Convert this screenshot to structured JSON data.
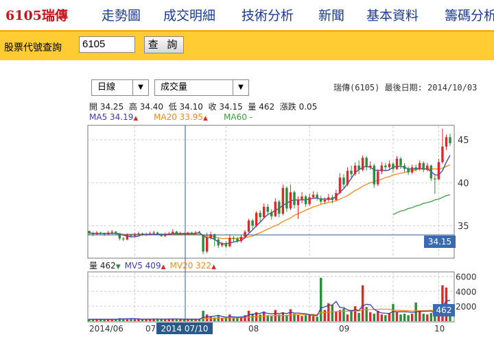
{
  "nav": {
    "brand": "6105瑞傳",
    "items": [
      "走勢圖",
      "成交明細",
      "技術分析",
      "新聞",
      "基本資料",
      "籌碼分析"
    ]
  },
  "query": {
    "label": "股票代號查詢",
    "value": "6105",
    "button": "查 詢"
  },
  "selects": {
    "period": "日線",
    "indicator": "成交量"
  },
  "header": {
    "stock": "瑞傳(6105)",
    "last_date_label": "最後日期:",
    "last_date": "2014/10/03"
  },
  "ohlc": {
    "open_label": "開",
    "open": "34.25",
    "high_label": "高",
    "high": "34.40",
    "low_label": "低",
    "low": "34.10",
    "close_label": "收",
    "close": "34.15",
    "vol_label": "量",
    "vol": "462",
    "chg_label": "漲跌",
    "chg": "0.05"
  },
  "ma": {
    "ma5": "MA5 34.19",
    "ma20": "MA20 33.95",
    "ma60": "MA60 -",
    "ma5_color": "#3b3bb0",
    "ma20_color": "#f08a1a",
    "ma60_color": "#3c9a3c"
  },
  "vol_legend": {
    "vol": "量 462",
    "mv5": "MV5 409",
    "mv20": "MV20 322"
  },
  "colors": {
    "up": "#d92b2b",
    "down": "#2e8b3a",
    "badge": "#3a6bb0"
  },
  "chart_data": {
    "type": "candlestick",
    "price_ticks": [
      "45",
      "40",
      "35"
    ],
    "price_range": [
      31.3,
      46.6
    ],
    "volume_ticks": [
      "6000",
      "4000",
      "2000"
    ],
    "volume_range": [
      0,
      6500
    ],
    "x_ticks": [
      "2014/06",
      "07",
      "08",
      "09",
      "10"
    ],
    "cursor_date": "2014 07/10",
    "last_price_badge": "34.15",
    "last_volume_badge": "462",
    "candles": [
      [
        34.4,
        34.1,
        34.4,
        33.9
      ],
      [
        34.1,
        34.0,
        34.3,
        33.8
      ],
      [
        34.0,
        34.2,
        34.4,
        33.9
      ],
      [
        34.2,
        34.1,
        34.3,
        33.9
      ],
      [
        34.1,
        34.0,
        34.2,
        33.8
      ],
      [
        34.0,
        34.2,
        34.4,
        33.9
      ],
      [
        34.2,
        34.3,
        34.5,
        34.0
      ],
      [
        34.3,
        34.1,
        34.4,
        33.9
      ],
      [
        34.1,
        33.5,
        34.1,
        33.3
      ],
      [
        33.5,
        33.4,
        33.7,
        33.2
      ],
      [
        33.4,
        33.9,
        34.1,
        33.3
      ],
      [
        33.9,
        33.8,
        34.0,
        33.6
      ],
      [
        33.8,
        34.0,
        34.2,
        33.7
      ],
      [
        34.0,
        34.1,
        34.3,
        33.9
      ],
      [
        34.1,
        33.9,
        34.2,
        33.8
      ],
      [
        33.9,
        34.0,
        34.2,
        33.8
      ],
      [
        34.0,
        34.1,
        34.3,
        33.9
      ],
      [
        34.1,
        34.2,
        34.4,
        34.0
      ],
      [
        34.2,
        34.0,
        34.3,
        33.9
      ],
      [
        34.0,
        33.8,
        34.1,
        33.7
      ],
      [
        33.8,
        34.0,
        34.2,
        33.7
      ],
      [
        34.0,
        34.1,
        34.3,
        33.9
      ],
      [
        34.1,
        34.3,
        34.6,
        34.0
      ],
      [
        34.3,
        34.0,
        34.4,
        33.9
      ],
      [
        34.0,
        34.1,
        34.3,
        33.9
      ],
      [
        34.1,
        34.0,
        34.2,
        33.9
      ],
      [
        34.0,
        34.2,
        34.3,
        33.9
      ],
      [
        34.2,
        34.1,
        34.3,
        34.0
      ],
      [
        34.1,
        34.2,
        34.4,
        34.0
      ],
      [
        34.3,
        34.2,
        34.4,
        34.1
      ],
      [
        33.9,
        32.0,
        34.0,
        31.7
      ],
      [
        32.0,
        33.6,
        34.2,
        31.8
      ],
      [
        33.6,
        34.0,
        34.3,
        33.4
      ],
      [
        34.0,
        33.4,
        34.1,
        32.6
      ],
      [
        33.4,
        32.7,
        33.6,
        32.4
      ],
      [
        32.7,
        32.9,
        33.1,
        32.5
      ],
      [
        32.9,
        32.6,
        33.2,
        32.4
      ],
      [
        32.6,
        33.6,
        34.0,
        32.5
      ],
      [
        33.6,
        33.5,
        33.8,
        33.1
      ],
      [
        33.5,
        33.2,
        33.7,
        33.0
      ],
      [
        33.2,
        33.7,
        33.9,
        33.0
      ],
      [
        33.7,
        34.3,
        34.5,
        33.5
      ],
      [
        34.3,
        35.6,
        35.8,
        34.2
      ],
      [
        35.6,
        35.0,
        35.8,
        34.6
      ],
      [
        35.0,
        36.5,
        36.7,
        34.8
      ],
      [
        36.5,
        36.0,
        36.8,
        35.5
      ],
      [
        36.0,
        37.2,
        37.6,
        35.8
      ],
      [
        37.2,
        36.6,
        37.5,
        36.2
      ],
      [
        36.6,
        36.1,
        36.9,
        35.7
      ],
      [
        36.1,
        37.8,
        38.2,
        36.0
      ],
      [
        37.8,
        36.4,
        38.0,
        36.0
      ],
      [
        36.4,
        39.4,
        39.8,
        36.2
      ],
      [
        39.4,
        37.0,
        39.6,
        36.6
      ],
      [
        37.0,
        38.9,
        39.8,
        36.8
      ],
      [
        38.9,
        37.4,
        39.1,
        37.0
      ],
      [
        37.4,
        38.0,
        38.4,
        35.8
      ],
      [
        38.0,
        38.4,
        38.9,
        37.6
      ],
      [
        38.4,
        37.5,
        38.6,
        37.2
      ],
      [
        37.5,
        38.3,
        38.7,
        37.3
      ],
      [
        38.3,
        38.6,
        39.0,
        38.1
      ],
      [
        38.6,
        38.2,
        38.9,
        37.9
      ],
      [
        38.2,
        37.8,
        38.5,
        37.5
      ],
      [
        37.8,
        38.0,
        38.3,
        37.5
      ],
      [
        38.0,
        38.3,
        38.7,
        37.8
      ],
      [
        38.3,
        38.0,
        38.6,
        37.6
      ],
      [
        38.0,
        38.8,
        39.2,
        37.9
      ],
      [
        38.8,
        40.6,
        41.1,
        38.7
      ],
      [
        40.6,
        39.8,
        41.0,
        39.4
      ],
      [
        39.8,
        41.4,
        41.8,
        39.6
      ],
      [
        41.4,
        41.0,
        42.0,
        40.6
      ],
      [
        41.0,
        42.0,
        42.4,
        40.8
      ],
      [
        42.0,
        41.5,
        42.6,
        41.0
      ],
      [
        41.5,
        42.9,
        43.2,
        41.3
      ],
      [
        42.9,
        41.8,
        43.1,
        41.4
      ],
      [
        41.8,
        42.0,
        42.5,
        41.5
      ],
      [
        42.0,
        39.8,
        42.2,
        39.4
      ],
      [
        39.8,
        41.3,
        41.6,
        39.6
      ],
      [
        41.3,
        42.0,
        42.4,
        41.0
      ],
      [
        42.0,
        41.8,
        42.3,
        41.4
      ],
      [
        41.8,
        42.2,
        42.6,
        41.5
      ],
      [
        42.2,
        41.6,
        42.4,
        41.2
      ],
      [
        41.6,
        42.8,
        43.1,
        41.5
      ],
      [
        42.8,
        42.0,
        43.0,
        41.6
      ],
      [
        42.0,
        41.6,
        42.3,
        41.2
      ],
      [
        41.6,
        41.2,
        41.9,
        40.9
      ],
      [
        41.2,
        41.8,
        42.1,
        41.0
      ],
      [
        41.8,
        41.6,
        42.1,
        41.3
      ],
      [
        41.6,
        42.3,
        42.6,
        41.4
      ],
      [
        42.3,
        41.5,
        42.5,
        41.2
      ],
      [
        41.5,
        42.0,
        42.3,
        41.3
      ],
      [
        42.0,
        40.5,
        42.1,
        40.2
      ],
      [
        40.5,
        40.4,
        40.8,
        38.7
      ],
      [
        40.4,
        42.4,
        42.8,
        40.3
      ],
      [
        42.4,
        44.2,
        46.3,
        42.2
      ],
      [
        44.2,
        45.3,
        45.6,
        43.8
      ],
      [
        45.3,
        44.6,
        45.7,
        44.3
      ]
    ],
    "ma5": [
      34.2,
      34.1,
      34.1,
      34.1,
      34.1,
      34.1,
      34.1,
      34.1,
      34.0,
      33.9,
      33.8,
      33.7,
      33.7,
      33.8,
      34.0,
      34.0,
      34.0,
      34.0,
      34.0,
      34.0,
      34.0,
      34.0,
      34.1,
      34.1,
      34.1,
      34.1,
      34.1,
      34.1,
      34.1,
      34.2,
      33.8,
      33.6,
      33.6,
      33.4,
      33.1,
      32.9,
      32.9,
      33.0,
      33.1,
      33.2,
      33.3,
      33.6,
      34.1,
      34.5,
      35.0,
      35.4,
      35.9,
      36.3,
      36.5,
      36.8,
      37.0,
      37.4,
      37.6,
      37.9,
      38.0,
      38.0,
      38.0,
      38.0,
      38.1,
      38.2,
      38.2,
      38.1,
      38.1,
      38.1,
      38.1,
      38.4,
      38.9,
      39.3,
      39.9,
      40.5,
      41.2,
      41.5,
      41.8,
      41.9,
      41.8,
      41.5,
      41.4,
      41.5,
      41.4,
      41.5,
      41.8,
      41.9,
      41.9,
      41.8,
      41.6,
      41.6,
      41.6,
      41.7,
      41.6,
      41.6,
      41.3,
      40.9,
      40.9,
      41.4,
      42.4,
      43.2
    ],
    "ma20": [
      34.1,
      34.1,
      34.1,
      34.1,
      34.1,
      34.1,
      34.1,
      34.1,
      34.1,
      34.0,
      34.0,
      34.0,
      34.0,
      34.0,
      34.0,
      34.0,
      34.0,
      34.0,
      34.0,
      34.0,
      34.0,
      34.0,
      34.0,
      34.0,
      34.0,
      34.0,
      34.0,
      34.0,
      34.0,
      34.0,
      33.9,
      33.8,
      33.8,
      33.7,
      33.6,
      33.5,
      33.5,
      33.5,
      33.5,
      33.5,
      33.6,
      33.6,
      33.7,
      33.8,
      34.0,
      34.2,
      34.4,
      34.6,
      34.8,
      35.0,
      35.2,
      35.5,
      35.7,
      35.9,
      36.2,
      36.4,
      36.6,
      36.8,
      37.0,
      37.2,
      37.3,
      37.5,
      37.6,
      37.7,
      37.8,
      37.9,
      38.1,
      38.3,
      38.5,
      38.8,
      39.1,
      39.3,
      39.6,
      39.8,
      40.0,
      40.1,
      40.3,
      40.4,
      40.6,
      40.7,
      40.9,
      41.0,
      41.1,
      41.2,
      41.3,
      41.4,
      41.5,
      41.6,
      41.6,
      41.6,
      41.6,
      41.6,
      41.6,
      41.7,
      41.9,
      42.1
    ],
    "ma60": [
      null,
      null,
      null,
      null,
      null,
      null,
      null,
      null,
      null,
      null,
      null,
      null,
      null,
      null,
      null,
      null,
      null,
      null,
      null,
      null,
      null,
      null,
      null,
      null,
      null,
      null,
      null,
      null,
      null,
      null,
      null,
      null,
      null,
      null,
      null,
      null,
      null,
      null,
      null,
      null,
      null,
      null,
      null,
      null,
      null,
      null,
      null,
      null,
      null,
      null,
      null,
      null,
      null,
      null,
      null,
      null,
      null,
      null,
      null,
      null,
      null,
      null,
      null,
      null,
      null,
      null,
      null,
      null,
      null,
      null,
      null,
      null,
      null,
      null,
      null,
      null,
      null,
      null,
      null,
      null,
      36.3,
      36.5,
      36.7,
      36.8,
      37.0,
      37.1,
      37.3,
      37.4,
      37.6,
      37.7,
      37.8,
      38.0,
      38.1,
      38.3,
      38.5,
      38.6
    ],
    "volume": [
      300,
      250,
      200,
      280,
      220,
      260,
      300,
      250,
      400,
      350,
      300,
      280,
      260,
      300,
      250,
      270,
      290,
      300,
      260,
      240,
      280,
      300,
      350,
      260,
      240,
      250,
      270,
      260,
      280,
      300,
      1400,
      900,
      600,
      500,
      700,
      400,
      450,
      900,
      500,
      400,
      600,
      800,
      1400,
      1000,
      1200,
      900,
      1300,
      800,
      700,
      1500,
      900,
      1200,
      800,
      1600,
      1000,
      900,
      700,
      800,
      900,
      700,
      600,
      5800,
      1500,
      2400,
      2200,
      1300,
      1500,
      1700,
      900,
      1500,
      2000,
      1100,
      4800,
      1900,
      1200,
      1000,
      1400,
      900,
      800,
      1100,
      2300,
      1200,
      900,
      1000,
      800,
      1000,
      2500,
      1300,
      1000,
      900,
      1100,
      900,
      2000,
      4800,
      4500,
      1800
    ],
    "mv5": [
      270,
      260,
      250,
      260,
      250,
      250,
      260,
      260,
      290,
      310,
      320,
      340,
      330,
      300,
      270,
      270,
      270,
      280,
      280,
      270,
      270,
      280,
      290,
      280,
      280,
      270,
      260,
      260,
      260,
      270,
      510,
      560,
      620,
      680,
      800,
      620,
      530,
      590,
      590,
      530,
      570,
      580,
      840,
      940,
      1000,
      1060,
      1160,
      1040,
      980,
      1040,
      1040,
      1100,
      1020,
      1200,
      1100,
      1080,
      1040,
      1000,
      860,
      800,
      740,
      1760,
      1900,
      2140,
      2160,
      2640,
      1820,
      1820,
      1520,
      1380,
      1520,
      1440,
      2060,
      2260,
      2200,
      1600,
      1260,
      1100,
      1060,
      1040,
      1300,
      1260,
      1260,
      1260,
      1240,
      1180,
      1240,
      1320,
      1320,
      1340,
      1360,
      1040,
      1180,
      1940,
      2680,
      2800
    ],
    "mv20": [
      260,
      260,
      260,
      260,
      260,
      260,
      260,
      260,
      270,
      270,
      280,
      280,
      280,
      280,
      280,
      280,
      280,
      280,
      280,
      280,
      280,
      280,
      280,
      280,
      280,
      280,
      280,
      280,
      280,
      280,
      340,
      370,
      380,
      390,
      410,
      410,
      420,
      450,
      460,
      470,
      480,
      500,
      550,
      580,
      610,
      640,
      680,
      700,
      720,
      770,
      740,
      760,
      780,
      820,
      840,
      870,
      880,
      890,
      900,
      900,
      880,
      1120,
      1160,
      1200,
      1250,
      1280,
      1310,
      1340,
      1340,
      1340,
      1370,
      1360,
      1530,
      1550,
      1560,
      1570,
      1600,
      1610,
      1600,
      1610,
      1460,
      1470,
      1450,
      1430,
      1410,
      1360,
      1410,
      1400,
      1410,
      1420,
      1440,
      1400,
      1350,
      1440,
      1580,
      1600
    ]
  }
}
